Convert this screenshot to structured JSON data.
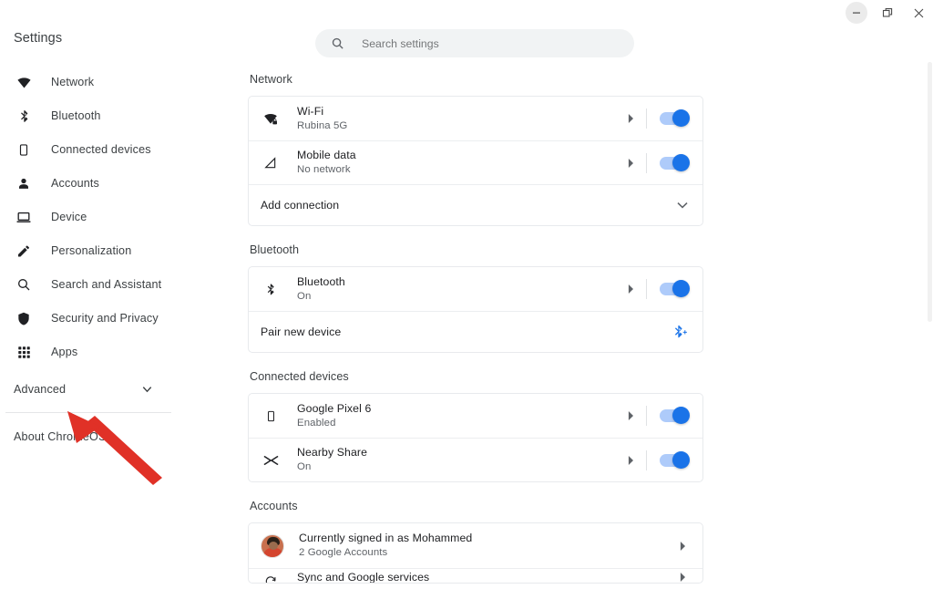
{
  "window": {
    "controls": [
      {
        "name": "minimize",
        "label": "Minimize"
      },
      {
        "name": "restore",
        "label": "Restore"
      },
      {
        "name": "close",
        "label": "Close"
      }
    ]
  },
  "sidebar": {
    "title": "Settings",
    "items": [
      {
        "label": "Network",
        "icon": "wifi-icon"
      },
      {
        "label": "Bluetooth",
        "icon": "bluetooth-icon"
      },
      {
        "label": "Connected devices",
        "icon": "phone-icon"
      },
      {
        "label": "Accounts",
        "icon": "person-icon"
      },
      {
        "label": "Device",
        "icon": "laptop-icon"
      },
      {
        "label": "Personalization",
        "icon": "pen-icon"
      },
      {
        "label": "Search and Assistant",
        "icon": "search-icon"
      },
      {
        "label": "Security and Privacy",
        "icon": "shield-icon"
      },
      {
        "label": "Apps",
        "icon": "grid-icon"
      }
    ],
    "advanced": "Advanced",
    "about": "About ChromeOS"
  },
  "search": {
    "placeholder": "Search settings",
    "value": ""
  },
  "sections": {
    "network": {
      "heading": "Network",
      "wifi": {
        "title": "Wi-Fi",
        "sub": "Rubina 5G",
        "toggle": "on"
      },
      "mobile": {
        "title": "Mobile data",
        "sub": "No network",
        "toggle": "on"
      },
      "add_connection": "Add connection"
    },
    "bluetooth": {
      "heading": "Bluetooth",
      "main": {
        "title": "Bluetooth",
        "sub": "On",
        "toggle": "on"
      },
      "pair": "Pair new device"
    },
    "connected_devices": {
      "heading": "Connected devices",
      "pixel": {
        "title": "Google Pixel 6",
        "sub": "Enabled",
        "toggle": "on"
      },
      "nearby": {
        "title": "Nearby Share",
        "sub": "On",
        "toggle": "on"
      }
    },
    "accounts": {
      "heading": "Accounts",
      "signed_in": {
        "title": "Currently signed in as Mohammed",
        "sub": "2 Google Accounts"
      },
      "sync": {
        "title": "Sync and Google services"
      }
    }
  },
  "annotation": {
    "type": "arrow",
    "color": "#e03127",
    "points_to": "About ChromeOS"
  },
  "colors": {
    "toggle_track": "#aecbfa",
    "toggle_knob": "#1a73e8",
    "accent": "#1a73e8",
    "text_primary": "#202124",
    "text_secondary": "#5f6368",
    "card_border": "#e8eaed",
    "search_bg": "#f1f3f4"
  }
}
